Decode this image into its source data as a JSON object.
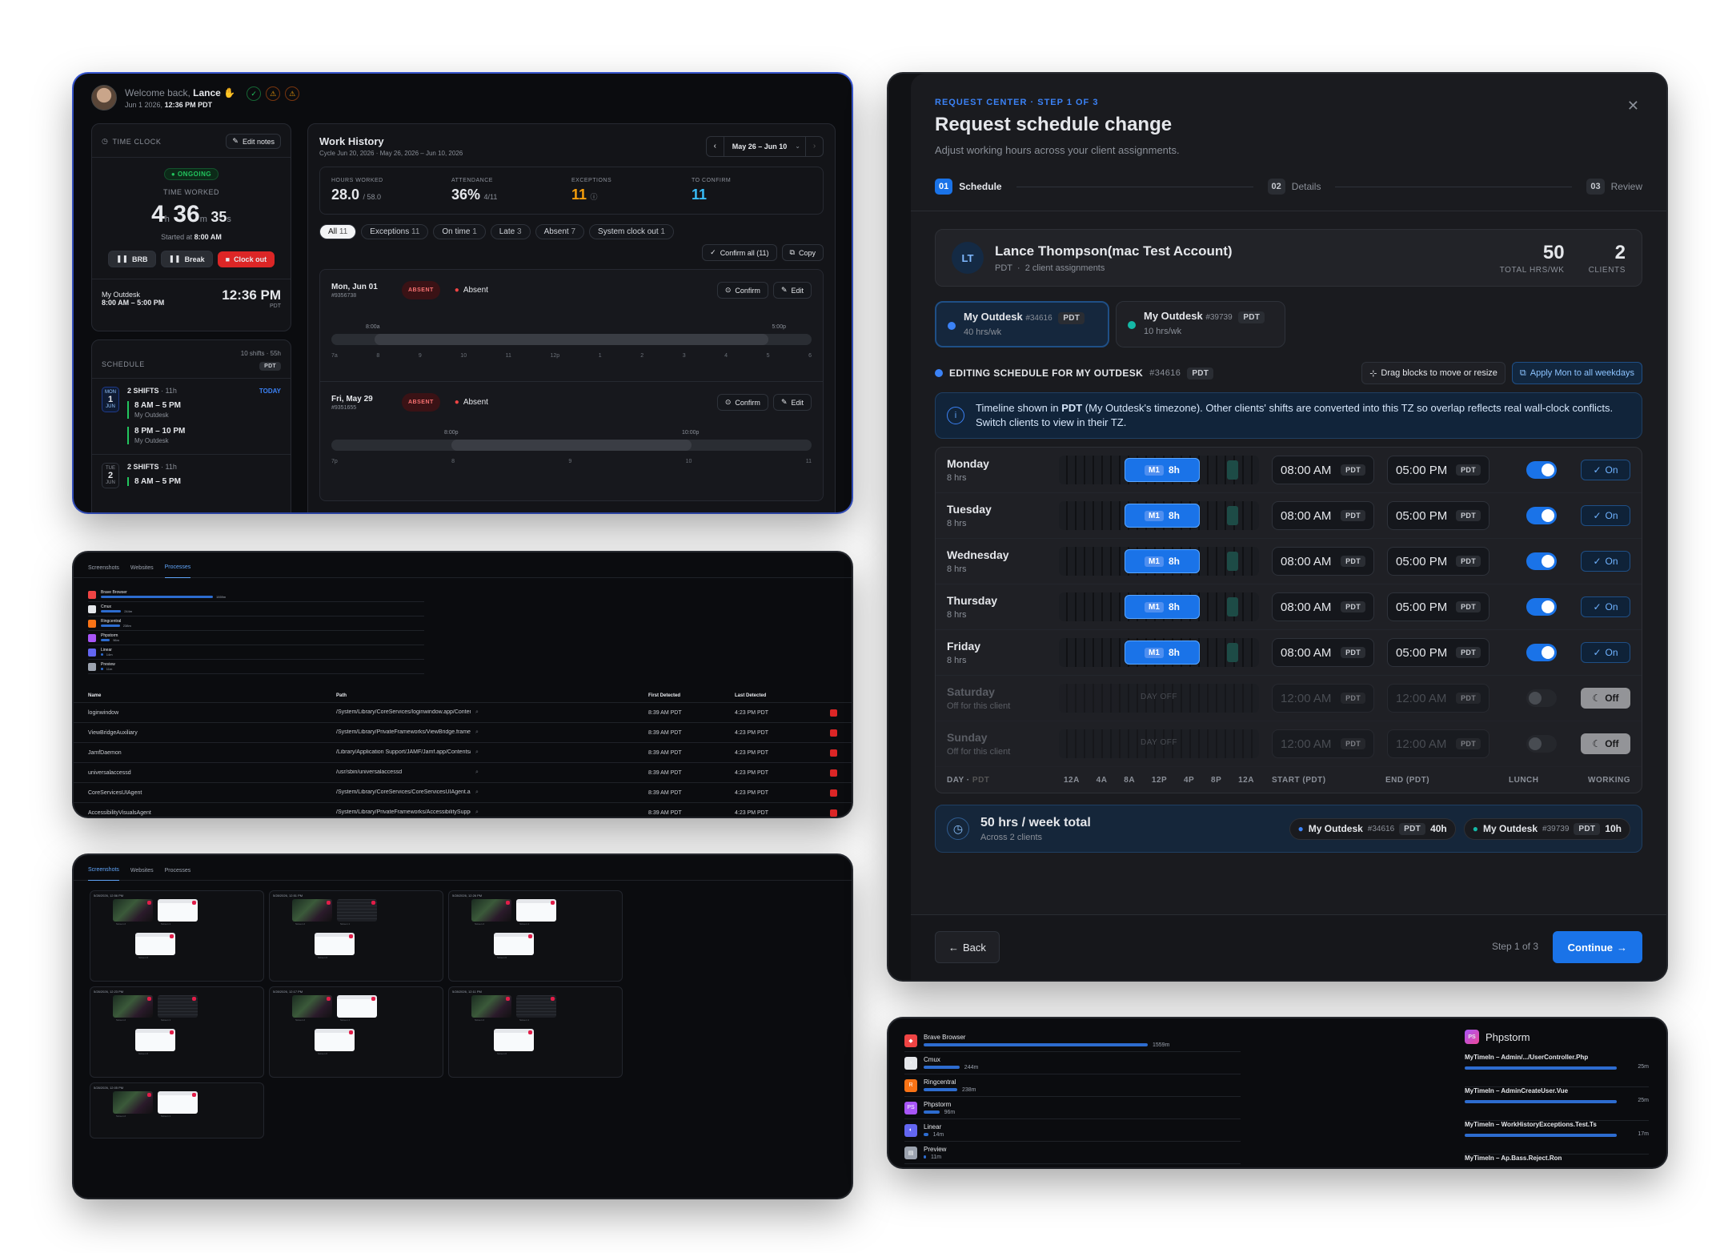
{
  "colors": {
    "accent": "#1a73e8",
    "danger": "#dc2626",
    "success": "#22c55e",
    "warning": "#f59e0b"
  },
  "tc": {
    "welcome": "Welcome back,",
    "user": "Lance",
    "date": "Jun 1 2026,",
    "time": "12:36 PM PDT",
    "time_clock": "TIME CLOCK",
    "edit_notes": "Edit notes",
    "ongoing": "ONGOING",
    "time_worked": "TIME WORKED",
    "h": "4",
    "h_u": "h",
    "m": "36",
    "m_u": "m",
    "s": "35",
    "s_u": "s",
    "started": "Started at",
    "started_time": "8:00 AM",
    "brb": "BRB",
    "break": "Break",
    "clock_out": "Clock out",
    "client": "My Outdesk",
    "client_hours": "8:00 AM – 5:00 PM",
    "now": "12:36 PM",
    "tz": "PDT",
    "schedule": "SCHEDULE",
    "sched_meta": "10 shifts · 55h",
    "sched_tz": "PDT",
    "d1_dow": "MON",
    "d1_num": "1",
    "d1_mon": "JUN",
    "d1_shifts": "2 SHIFTS",
    "d1_len": "· 11h",
    "today": "TODAY",
    "s1_time": "8 AM – 5 PM",
    "s1_client": "My Outdesk",
    "s2_time": "8 PM – 10 PM",
    "s2_client": "My Outdesk",
    "d2_dow": "TUE",
    "d2_num": "2",
    "d2_mon": "JUN",
    "d2_shifts": "2 SHIFTS",
    "d2_len": "· 11h",
    "s3_time": "8 AM – 5 PM",
    "wh_title": "Work History",
    "wh_cycle": "Cycle Jun 20, 2026 · May 26, 2026 – Jun 10, 2026",
    "wh_range": "May 26 – Jun 10",
    "k1_l": "HOURS WORKED",
    "k1_v": "28.0",
    "k1_s": "/ 58.0",
    "k2_l": "ATTENDANCE",
    "k2_v": "36%",
    "k2_s": "4/11",
    "k3_l": "EXCEPTIONS",
    "k3_v": "11",
    "k4_l": "TO CONFIRM",
    "k4_v": "11",
    "filters": [
      {
        "l": "All",
        "n": "11"
      },
      {
        "l": "Exceptions",
        "n": "11"
      },
      {
        "l": "On time",
        "n": "1"
      },
      {
        "l": "Late",
        "n": "3"
      },
      {
        "l": "Absent",
        "n": "7"
      },
      {
        "l": "System clock out",
        "n": "1"
      }
    ],
    "confirm_all": "Confirm all (11)",
    "copy": "Copy",
    "e1_date": "Mon, Jun 01",
    "e1_id": "#9356738",
    "absent_badge": "ABSENT",
    "absent": "Absent",
    "confirm": "Confirm",
    "edit": "Edit",
    "e1_start": "8:00a",
    "e1_end": "5:00p",
    "e1_ticks": [
      "7a",
      "8",
      "9",
      "10",
      "11",
      "12p",
      "1",
      "2",
      "3",
      "4",
      "5",
      "6"
    ],
    "e2_date": "Fri, May 29",
    "e2_id": "#9351655",
    "e2_start": "8:00p",
    "e2_end": "10:00p",
    "e2_ticks": [
      "7p",
      "8",
      "9",
      "10",
      "11"
    ]
  },
  "pr": {
    "tabs": [
      "Screenshots",
      "Websites",
      "Processes"
    ],
    "apps": [
      {
        "n": "Brave Browser",
        "v": "1559m",
        "f": 100
      },
      {
        "n": "Cmux",
        "v": "244m",
        "f": 18
      },
      {
        "n": "Ringcentral",
        "v": "238m",
        "f": 17
      },
      {
        "n": "Phpstorm",
        "v": "96m",
        "f": 8
      },
      {
        "n": "Linear",
        "v": "14m",
        "f": 2
      },
      {
        "n": "Preview",
        "v": "11m",
        "f": 2
      }
    ],
    "cols": [
      "Name",
      "Path",
      "First Detected",
      "Last Detected"
    ],
    "rows": [
      {
        "n": "loginwindow",
        "p": "/System/Library/CoreServices/loginwindow.app/Conten...",
        "f": "8:39 AM PDT",
        "l": "4:23 PM PDT"
      },
      {
        "n": "ViewBridgeAuxiliary",
        "p": "/System/Library/PrivateFrameworks/ViewBridge.framew...",
        "f": "8:39 AM PDT",
        "l": "4:23 PM PDT"
      },
      {
        "n": "JamfDaemon",
        "p": "/Library/Application Support/JAMF/Jamf.app/Contents/...",
        "f": "8:39 AM PDT",
        "l": "4:23 PM PDT"
      },
      {
        "n": "universalaccessd",
        "p": "/usr/sbin/universalaccessd",
        "f": "8:39 AM PDT",
        "l": "4:23 PM PDT"
      },
      {
        "n": "CoreServicesUIAgent",
        "p": "/System/Library/CoreServices/CoreServicesUIAgent.ap...",
        "f": "8:39 AM PDT",
        "l": "4:23 PM PDT"
      },
      {
        "n": "AccessibilityVisualsAgent",
        "p": "/System/Library/PrivateFrameworks/AccessibilitySuppo...",
        "f": "8:39 AM PDT",
        "l": "4:23 PM PDT"
      }
    ]
  },
  "ss": {
    "tabs": [
      "Screenshots",
      "Websites",
      "Processes"
    ],
    "cards": [
      {
        "t": "5/28/2026, 12:56 PM"
      },
      {
        "t": "5/28/2026, 12:51 PM"
      },
      {
        "t": "5/28/2026, 12:26 PM"
      },
      {
        "t": "5/28/2026, 12:23 PM"
      },
      {
        "t": "5/28/2026, 12:17 PM"
      },
      {
        "t": "5/28/2026, 12:11 PM"
      },
      {
        "t": "5/28/2026, 12:05 PM"
      }
    ],
    "screen1": "Screen 1",
    "screen2": "Screen 2",
    "screen0": "Screen 0"
  },
  "rq": {
    "eyebrow": "REQUEST CENTER · STEP 1 OF 3",
    "title": "Request schedule change",
    "subtitle": "Adjust working hours across your client assignments.",
    "steps": [
      {
        "n": "01",
        "l": "Schedule"
      },
      {
        "n": "02",
        "l": "Details"
      },
      {
        "n": "03",
        "l": "Review"
      }
    ],
    "initials": "LT",
    "name": "Lance Thompson(mac Test Account)",
    "tz": "PDT",
    "assign": "2 client assignments",
    "total_v": "50",
    "total_l": "TOTAL HRS/WK",
    "clients_v": "2",
    "clients_l": "CLIENTS",
    "c1_name": "My Outdesk",
    "c1_id": "#34616",
    "c1_tz": "PDT",
    "c1_hrs": "40 hrs/wk",
    "c2_name": "My Outdesk",
    "c2_id": "#39739",
    "c2_tz": "PDT",
    "c2_hrs": "10 hrs/wk",
    "editing": "EDITING SCHEDULE FOR MY OUTDESK",
    "editing_id": "#34616",
    "editing_tz": "PDT",
    "drag": "Drag blocks to move or resize",
    "apply": "Apply Mon to all weekdays",
    "info_a": "Timeline shown in ",
    "info_b": "PDT",
    "info_c": " (My Outdesk's timezone). Other clients' shifts are converted into this TZ so overlap reflects real wall-clock conflicts. Switch clients to view in their TZ.",
    "days": [
      {
        "n": "Monday",
        "h": "8 hrs",
        "on": true
      },
      {
        "n": "Tuesday",
        "h": "8 hrs",
        "on": true
      },
      {
        "n": "Wednesday",
        "h": "8 hrs",
        "on": true
      },
      {
        "n": "Thursday",
        "h": "8 hrs",
        "on": true
      },
      {
        "n": "Friday",
        "h": "8 hrs",
        "on": true
      },
      {
        "n": "Saturday",
        "h": "Off for this client",
        "on": false
      },
      {
        "n": "Sunday",
        "h": "Off for this client",
        "on": false
      }
    ],
    "m1": "M1",
    "blk": "8h",
    "start": "08:00 AM",
    "end": "05:00 PM",
    "off_time": "12:00 AM",
    "pdt": "PDT",
    "day_off": "DAY OFF",
    "on_l": "On",
    "off_l": "Off",
    "foot_day": "DAY",
    "foot_tz": "PDT",
    "foot_ticks": [
      "12A",
      "4A",
      "8A",
      "12P",
      "4P",
      "8P",
      "12A"
    ],
    "foot_start": "START (PDT)",
    "foot_end": "END (PDT)",
    "foot_lunch": "LUNCH",
    "foot_working": "WORKING",
    "sum_title": "50 hrs / week total",
    "sum_sub": "Across 2 clients",
    "s1_name": "My Outdesk",
    "s1_id": "#34616",
    "s1_tz": "PDT",
    "s1_h": "40h",
    "s2_name": "My Outdesk",
    "s2_id": "#39739",
    "s2_tz": "PDT",
    "s2_h": "10h",
    "back": "Back",
    "step": "Step 1 of 3",
    "continue": "Continue"
  },
  "ap": {
    "apps": [
      {
        "n": "Brave Browser",
        "v": "1559m",
        "f": 100
      },
      {
        "n": "Cmux",
        "v": "244m",
        "f": 16
      },
      {
        "n": "Ringcentral",
        "v": "238m",
        "f": 15
      },
      {
        "n": "Phpstorm",
        "v": "96m",
        "f": 7
      },
      {
        "n": "Linear",
        "v": "14m",
        "f": 2
      },
      {
        "n": "Preview",
        "v": "11m",
        "f": 1
      }
    ],
    "detail": "Phpstorm",
    "files": [
      {
        "n": "MyTimeIn – Admin/.../UserController.Php",
        "v": "25m"
      },
      {
        "n": "MyTimeIn – AdminCreateUser.Vue",
        "v": "25m"
      },
      {
        "n": "MyTimeIn – WorkHistoryExceptions.Test.Ts",
        "v": "17m"
      },
      {
        "n": "MyTimeIn – Ap.Bass.Reject.Ron",
        "v": ""
      }
    ]
  }
}
